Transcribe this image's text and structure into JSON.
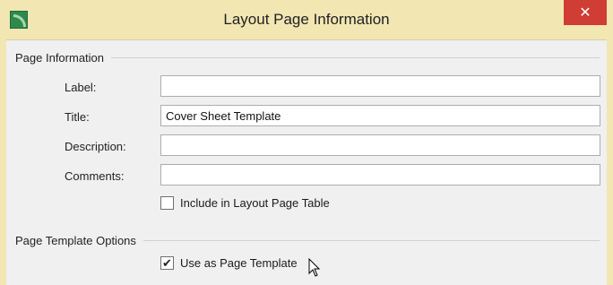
{
  "window": {
    "title": "Layout Page Information",
    "close_symbol": "✕",
    "app_icon": "app-logo-icon"
  },
  "page_information": {
    "header": "Page Information",
    "fields": [
      {
        "label": "Label:",
        "value": ""
      },
      {
        "label": "Title:",
        "value": "Cover Sheet Template"
      },
      {
        "label": "Description:",
        "value": ""
      },
      {
        "label": "Comments:",
        "value": ""
      }
    ],
    "include_checkbox": {
      "label": "Include in Layout Page Table",
      "checked": false
    }
  },
  "page_template_options": {
    "header": "Page Template Options",
    "use_template_checkbox": {
      "label": "Use as Page Template",
      "checked": true,
      "mark": "✔"
    }
  },
  "colors": {
    "titlebar": "#f2e6b3",
    "close_button": "#cf3d35",
    "client_bg": "#f0f0f0"
  }
}
